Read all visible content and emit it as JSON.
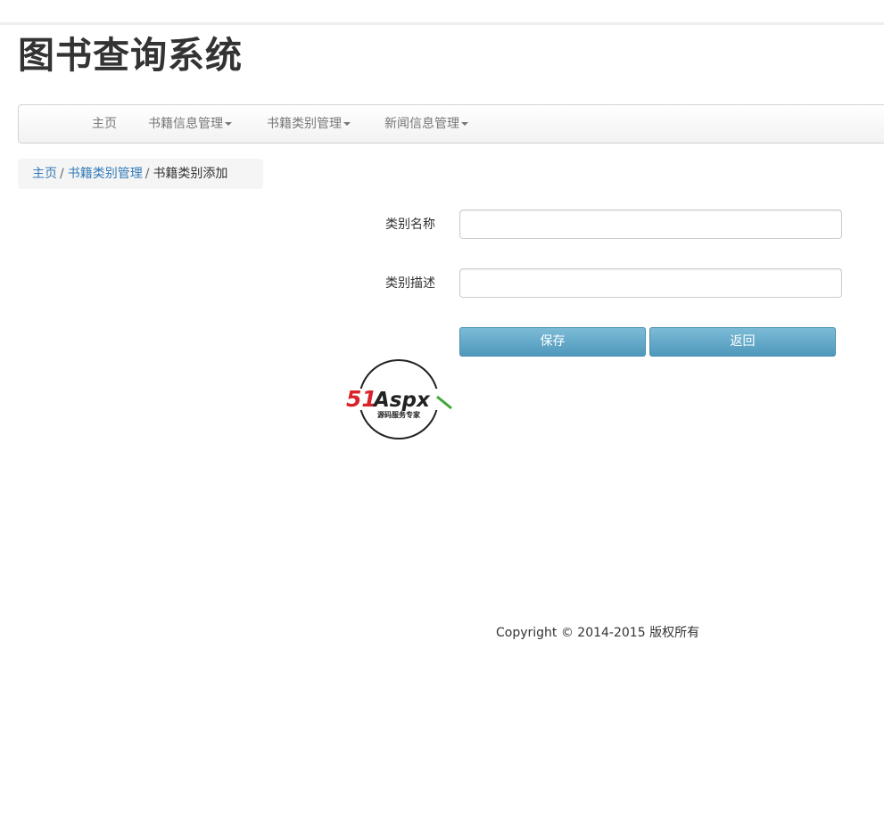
{
  "header": {
    "title": "图书查询系统"
  },
  "navbar": {
    "items": [
      {
        "label": "主页",
        "dropdown": false
      },
      {
        "label": "书籍信息管理",
        "dropdown": true
      },
      {
        "label": "书籍类别管理",
        "dropdown": true
      },
      {
        "label": "新闻信息管理",
        "dropdown": true
      }
    ]
  },
  "breadcrumb": {
    "items": [
      "主页",
      "书籍类别管理",
      "书籍类别添加"
    ],
    "separator": "/"
  },
  "form": {
    "category_name_label": "类别名称",
    "category_name_value": "",
    "category_desc_label": "类别描述",
    "category_desc_value": "",
    "save_label": "保存",
    "back_label": "返回"
  },
  "logo": {
    "brand_left": "51",
    "brand_right": "Aspx",
    "tagline": "源码服务专家"
  },
  "footer": {
    "copyright": "Copyright © 2014-2015 版权所有"
  },
  "colors": {
    "link": "#337ab7",
    "button": "#5ea5c6",
    "logo_red": "#d9232a",
    "logo_green": "#3aa935"
  }
}
